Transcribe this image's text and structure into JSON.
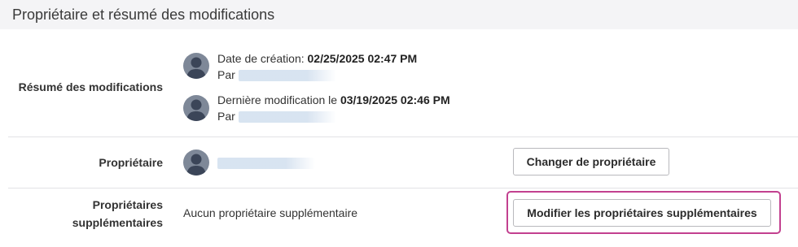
{
  "section": {
    "title": "Propriétaire et résumé des modifications"
  },
  "summary": {
    "label": "Résumé des modifications",
    "created_prefix": "Date de création: ",
    "created_value": "02/25/2025 02:47 PM",
    "created_by_label": "Par",
    "modified_prefix": "Dernière modification le ",
    "modified_value": "03/19/2025 02:46 PM",
    "modified_by_label": "Par"
  },
  "owner": {
    "label": "Propriétaire",
    "change_button": "Changer de propriétaire"
  },
  "additional_owners": {
    "label_line1": "Propriétaires",
    "label_line2": "supplémentaires",
    "empty_text": "Aucun propriétaire supplémentaire",
    "edit_button": "Modifier les propriétaires supplémentaires"
  },
  "colors": {
    "focus_ring": "#c2408f",
    "avatar": "#7e8898",
    "header_bg": "#f4f4f6"
  }
}
